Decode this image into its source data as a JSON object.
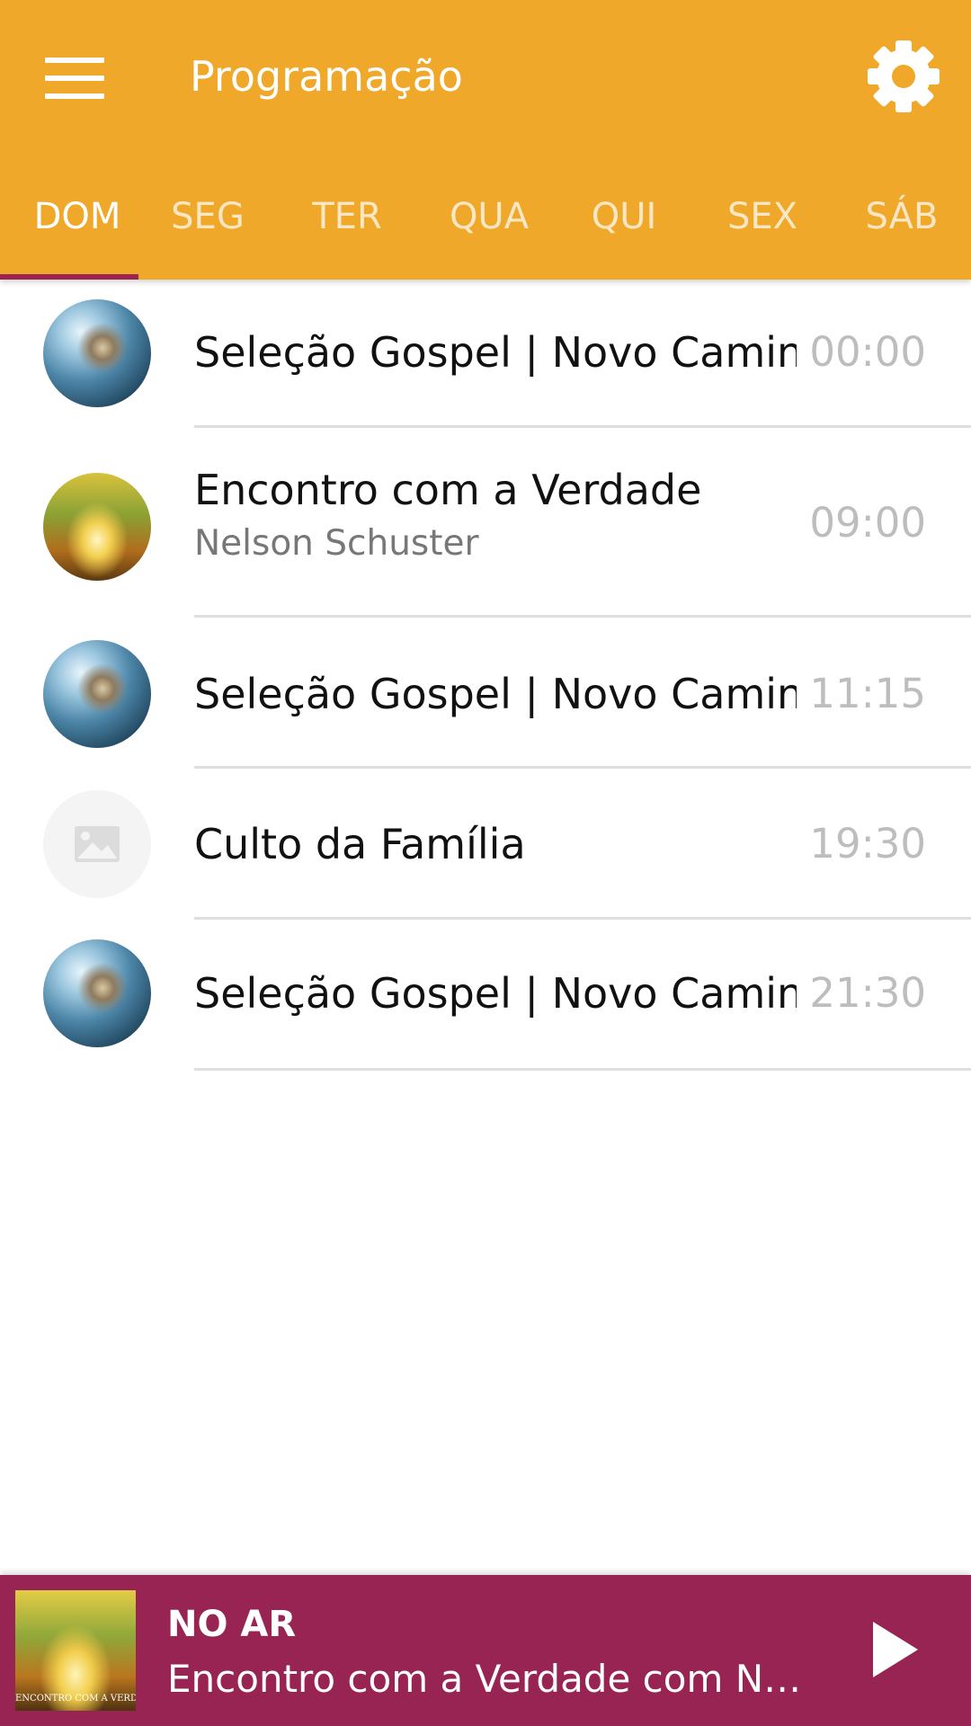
{
  "app": {
    "title": "Programação",
    "accent_color": "#EFA829",
    "player_color": "#972453",
    "tab_indicator_color": "#9B2550"
  },
  "toolbar": {
    "menu_icon": "hamburger-menu-icon",
    "settings_icon": "gear-icon"
  },
  "tabs": [
    {
      "label": "DOM",
      "active": true
    },
    {
      "label": "SEG",
      "active": false
    },
    {
      "label": "TER",
      "active": false
    },
    {
      "label": "QUA",
      "active": false
    },
    {
      "label": "QUI",
      "active": false
    },
    {
      "label": "SEX",
      "active": false
    },
    {
      "label": "SÁB",
      "active": false
    }
  ],
  "schedule": [
    {
      "title": "Seleção Gospel | Novo Caminho",
      "subtitle": "",
      "time": "00:00",
      "thumb": "gospel"
    },
    {
      "title": "Encontro com a Verdade",
      "subtitle": "Nelson Schuster",
      "time": "09:00",
      "thumb": "verdade"
    },
    {
      "title": "Seleção Gospel | Novo Caminho",
      "subtitle": "",
      "time": "11:15",
      "thumb": "gospel"
    },
    {
      "title": "Culto da Família",
      "subtitle": "",
      "time": "19:30",
      "thumb": "image-placeholder-icon"
    },
    {
      "title": "Seleção Gospel | Novo Caminho",
      "subtitle": "",
      "time": "21:30",
      "thumb": "gospel"
    }
  ],
  "player": {
    "label": "NO AR",
    "now_playing": "Encontro com a Verdade com Nelson Schuster",
    "thumb_text": "ENCONTRO COM A VERDADE",
    "play_icon": "play-icon"
  }
}
